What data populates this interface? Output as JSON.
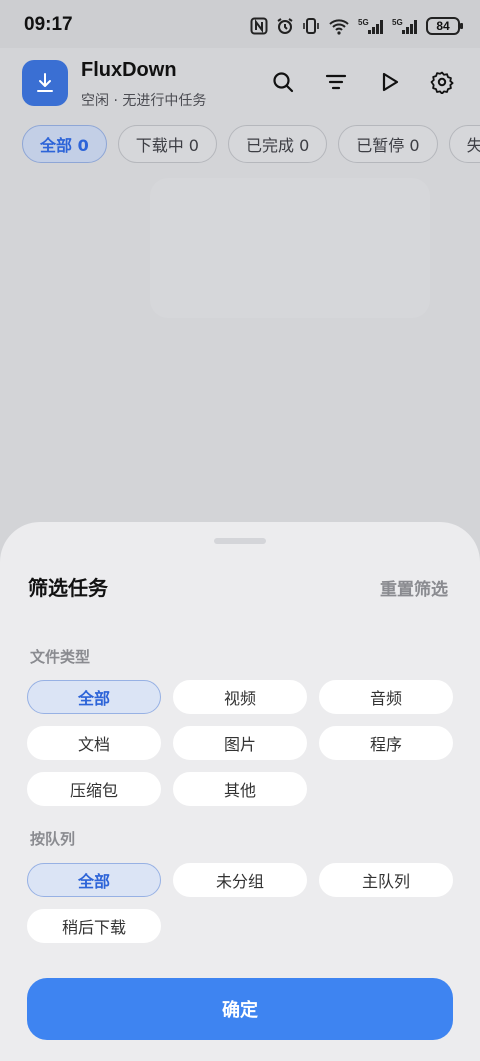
{
  "status_bar": {
    "time": "09:17",
    "battery": "84"
  },
  "app": {
    "title": "FluxDown",
    "subtitle": "空闲 · 无进行中任务",
    "tabs": [
      {
        "label": "全部 0",
        "active": true
      },
      {
        "label": "下载中 0",
        "active": false
      },
      {
        "label": "已完成 0",
        "active": false
      },
      {
        "label": "已暂停 0",
        "active": false
      },
      {
        "label": "失",
        "active": false
      }
    ]
  },
  "sheet": {
    "title": "筛选任务",
    "reset_label": "重置筛选",
    "file_type": {
      "label": "文件类型",
      "options": [
        {
          "label": "全部",
          "selected": true
        },
        {
          "label": "视频",
          "selected": false
        },
        {
          "label": "音频",
          "selected": false
        },
        {
          "label": "文档",
          "selected": false
        },
        {
          "label": "图片",
          "selected": false
        },
        {
          "label": "程序",
          "selected": false
        },
        {
          "label": "压缩包",
          "selected": false
        },
        {
          "label": "其他",
          "selected": false
        }
      ]
    },
    "queue": {
      "label": "按队列",
      "options": [
        {
          "label": "全部",
          "selected": true
        },
        {
          "label": "未分组",
          "selected": false
        },
        {
          "label": "主队列",
          "selected": false
        },
        {
          "label": "稍后下载",
          "selected": false
        }
      ]
    },
    "confirm_label": "确定"
  },
  "colors": {
    "accent": "#3e84f1",
    "selected_text": "#2d64d8",
    "sheet_bg": "#ececee",
    "scrim": "#cfd0d3"
  }
}
